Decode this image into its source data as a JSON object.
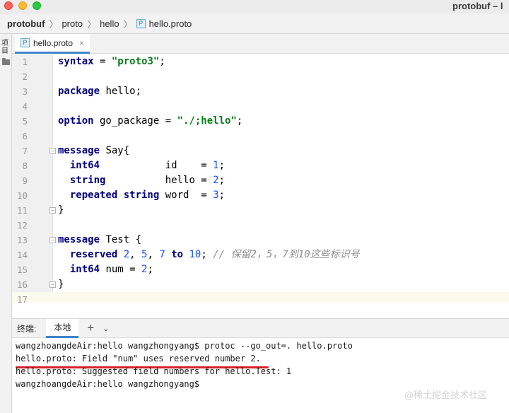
{
  "window": {
    "title": "protobuf – l"
  },
  "breadcrumb": {
    "items": [
      "protobuf",
      "proto",
      "hello",
      "hello.proto"
    ]
  },
  "sidebar": {
    "label": "项目"
  },
  "editor_tab": {
    "label": "hello.proto",
    "close": "×"
  },
  "editor": {
    "lines": [
      {
        "n": "1",
        "html": "<span class=\"kw\">syntax</span><span class=\"plain\"> = </span><span class=\"str\">\"proto3\"</span><span class=\"plain\">;</span>"
      },
      {
        "n": "2",
        "html": ""
      },
      {
        "n": "3",
        "html": "<span class=\"kw\">package</span><span class=\"plain\"> hello;</span>"
      },
      {
        "n": "4",
        "html": ""
      },
      {
        "n": "5",
        "html": "<span class=\"kw\">option</span><span class=\"plain\"> go_package = </span><span class=\"str\">\"./;hello\"</span><span class=\"plain\">;</span>"
      },
      {
        "n": "6",
        "html": ""
      },
      {
        "n": "7",
        "html": "<span class=\"kw\">message</span><span class=\"plain\"> Say{</span>",
        "fold": "−"
      },
      {
        "n": "8",
        "html": "<span class=\"plain\">  </span><span class=\"kw\">int64</span><span class=\"plain\">           id    = </span><span class=\"num\">1</span><span class=\"plain\">;</span>"
      },
      {
        "n": "9",
        "html": "<span class=\"plain\">  </span><span class=\"kw\">string</span><span class=\"plain\">          hello = </span><span class=\"num\">2</span><span class=\"plain\">;</span>"
      },
      {
        "n": "10",
        "html": "<span class=\"plain\">  </span><span class=\"kw\">repeated string</span><span class=\"plain\"> word  = </span><span class=\"num\">3</span><span class=\"plain\">;</span>"
      },
      {
        "n": "11",
        "html": "<span class=\"plain\">}</span>",
        "fold": "−"
      },
      {
        "n": "12",
        "html": ""
      },
      {
        "n": "13",
        "html": "<span class=\"kw\">message</span><span class=\"plain\"> Test {</span>",
        "fold": "−"
      },
      {
        "n": "14",
        "html": "<span class=\"plain\">  </span><span class=\"kw\">reserved</span><span class=\"plain\"> </span><span class=\"num\">2</span><span class=\"plain\">, </span><span class=\"num\">5</span><span class=\"plain\">, </span><span class=\"num\">7</span><span class=\"plain\"> </span><span class=\"kw\">to</span><span class=\"plain\"> </span><span class=\"num\">10</span><span class=\"plain\">; </span><span class=\"cmt\">// 保留2，5，7到10这些标识号</span>"
      },
      {
        "n": "15",
        "html": "<span class=\"plain\">  </span><span class=\"kw\">int64</span><span class=\"plain\"> num = </span><span class=\"num\">2</span><span class=\"plain\">;</span>"
      },
      {
        "n": "16",
        "html": "<span class=\"plain\">}</span>",
        "fold": "−"
      },
      {
        "n": "17",
        "html": "",
        "current": true
      }
    ]
  },
  "terminal": {
    "title": "终端:",
    "tab_label": "本地",
    "add_label": "+",
    "dropdown_label": "⌄",
    "lines": [
      "wangzhoangdeAir:hello wangzhongyang$ protoc --go_out=. hello.proto",
      "hello.proto: Field \"num\" uses reserved number 2.",
      "hello.proto: Suggested field numbers for hello.Test: 1",
      "wangzhoangdeAir:hello wangzhongyang$"
    ]
  },
  "watermark": "@稀土掘金技术社区"
}
